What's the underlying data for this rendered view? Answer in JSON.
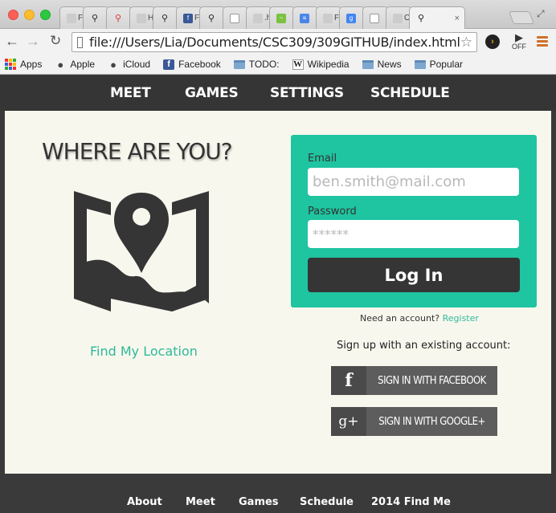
{
  "browser": {
    "tabs": [
      {
        "label": "Fir",
        "icon": "generic-page-icon"
      },
      {
        "label": "",
        "icon": "map-pin-icon"
      },
      {
        "label": "",
        "icon": "red-pin-icon"
      },
      {
        "label": "HT",
        "icon": "generic-page-icon"
      },
      {
        "label": "",
        "icon": "map-pin-icon"
      },
      {
        "label": "Fir",
        "icon": "facebook-icon"
      },
      {
        "label": "",
        "icon": "map-pin-icon"
      },
      {
        "label": "",
        "icon": "document-icon"
      },
      {
        "label": ".hi",
        "icon": "generic-page-icon"
      },
      {
        "label": "",
        "icon": "green-app-icon"
      },
      {
        "label": "",
        "icon": "google-docs-icon"
      },
      {
        "label": "Fir",
        "icon": "generic-page-icon"
      },
      {
        "label": "",
        "icon": "google-icon"
      },
      {
        "label": "",
        "icon": "document-icon"
      },
      {
        "label": "Or",
        "icon": "generic-page-icon"
      },
      {
        "label": "",
        "icon": "map-pin-icon"
      }
    ],
    "active_tab_close": "×",
    "url": "file:///Users/Lia/Documents/CSC309/309GITHUB/index.html",
    "ext_off_label": "OFF",
    "bookmarks": [
      {
        "label": "Apps",
        "icon": "apps-grid-icon"
      },
      {
        "label": "Apple",
        "icon": "apple-icon"
      },
      {
        "label": "iCloud",
        "icon": "apple-icon"
      },
      {
        "label": "Facebook",
        "icon": "facebook-icon"
      },
      {
        "label": "TODO:",
        "icon": "folder-icon"
      },
      {
        "label": "Wikipedia",
        "icon": "wikipedia-icon"
      },
      {
        "label": "News",
        "icon": "folder-icon"
      },
      {
        "label": "Popular",
        "icon": "folder-icon"
      }
    ]
  },
  "nav": {
    "meet": "MEET",
    "games": "GAMES",
    "settings": "SETTINGS",
    "schedule": "SCHEDULE"
  },
  "location": {
    "heading": "WHERE ARE YOU?",
    "find_link": "Find My Location"
  },
  "login": {
    "email_label": "Email",
    "email_placeholder": "ben.smith@mail.com",
    "password_label": "Password",
    "password_placeholder": "******",
    "button": "Log In"
  },
  "signup": {
    "need_account": "Need an account?",
    "register": "Register",
    "existing": "Sign up with an existing account:",
    "facebook": "SIGN IN WITH FACEBOOK",
    "facebook_glyph": "f",
    "google": "SIGN IN WITH GOOGLE+",
    "google_glyph": "g+"
  },
  "footer": {
    "about": "About",
    "meet": "Meet",
    "games": "Games",
    "schedule": "Schedule",
    "copyright": "2014 Find Me"
  }
}
